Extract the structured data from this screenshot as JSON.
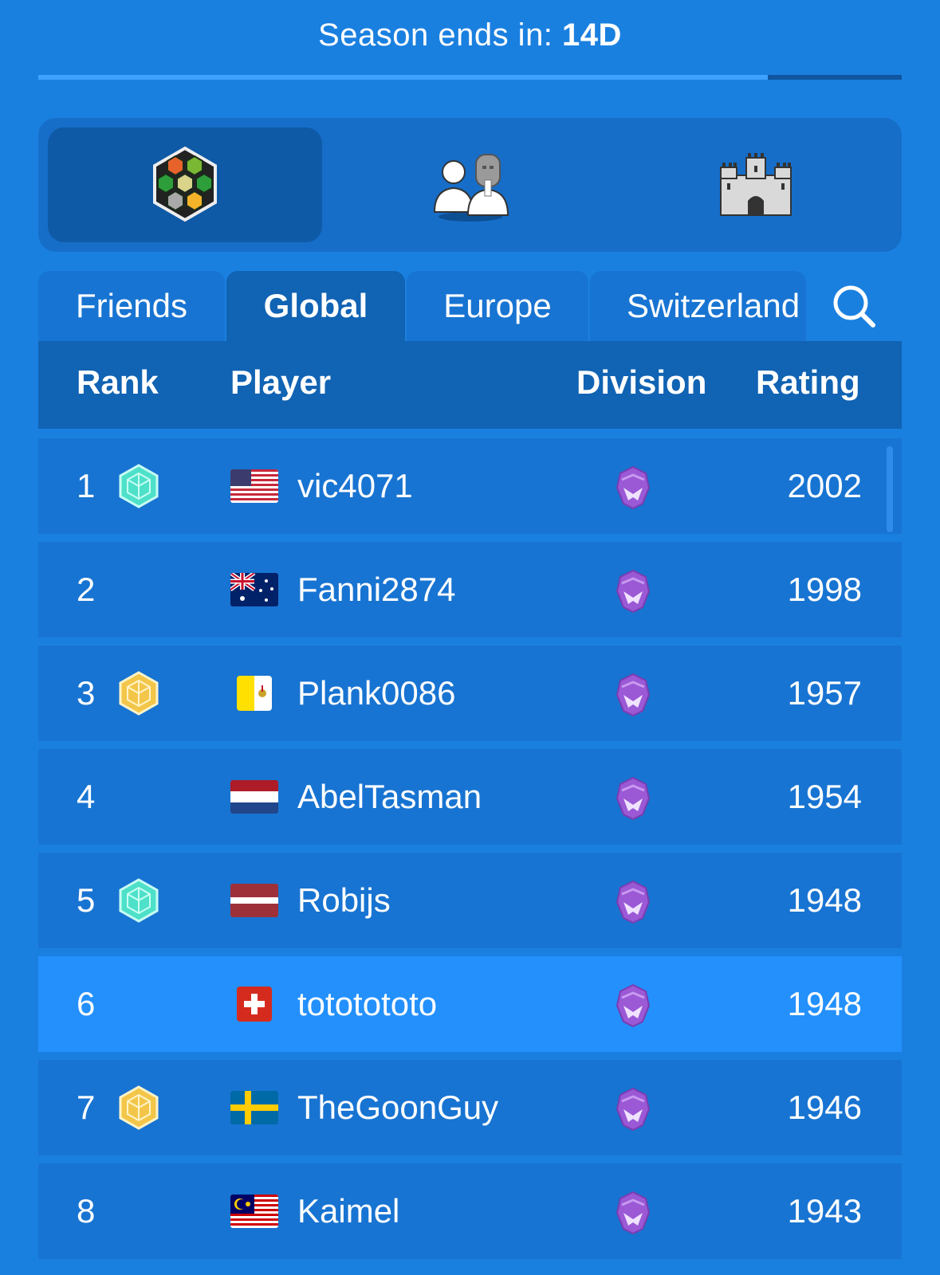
{
  "season": {
    "label": "Season ends in:",
    "value": "14D",
    "progress": 0.845
  },
  "modes": [
    {
      "name": "hex-board-icon",
      "active": true
    },
    {
      "name": "players-icon",
      "active": false
    },
    {
      "name": "castle-icon",
      "active": false
    }
  ],
  "tabs": [
    {
      "label": "Friends",
      "active": false
    },
    {
      "label": "Global",
      "active": true
    },
    {
      "label": "Europe",
      "active": false
    },
    {
      "label": "Switzerland",
      "active": false
    }
  ],
  "columns": {
    "rank": "Rank",
    "player": "Player",
    "division": "Division",
    "rating": "Rating"
  },
  "players": [
    {
      "rank": "1",
      "badge": "teal",
      "flag": "us",
      "name": "vic4071",
      "rating": "2002"
    },
    {
      "rank": "2",
      "badge": "",
      "flag": "au",
      "name": "Fanni2874",
      "rating": "1998"
    },
    {
      "rank": "3",
      "badge": "gold",
      "flag": "va",
      "name": "Plank0086",
      "rating": "1957"
    },
    {
      "rank": "4",
      "badge": "",
      "flag": "nl",
      "name": "AbelTasman",
      "rating": "1954"
    },
    {
      "rank": "5",
      "badge": "teal",
      "flag": "lv",
      "name": "Robijs",
      "rating": "1948"
    },
    {
      "rank": "6",
      "badge": "",
      "flag": "ch",
      "name": "tototototo",
      "rating": "1948",
      "highlight": true
    },
    {
      "rank": "7",
      "badge": "gold",
      "flag": "se",
      "name": "TheGoonGuy",
      "rating": "1946"
    },
    {
      "rank": "8",
      "badge": "",
      "flag": "my",
      "name": "Kaimel",
      "rating": "1943"
    }
  ],
  "colors": {
    "background": "#1a80e0",
    "highlight_row": "#2390fc",
    "division": "#9b59d6"
  }
}
